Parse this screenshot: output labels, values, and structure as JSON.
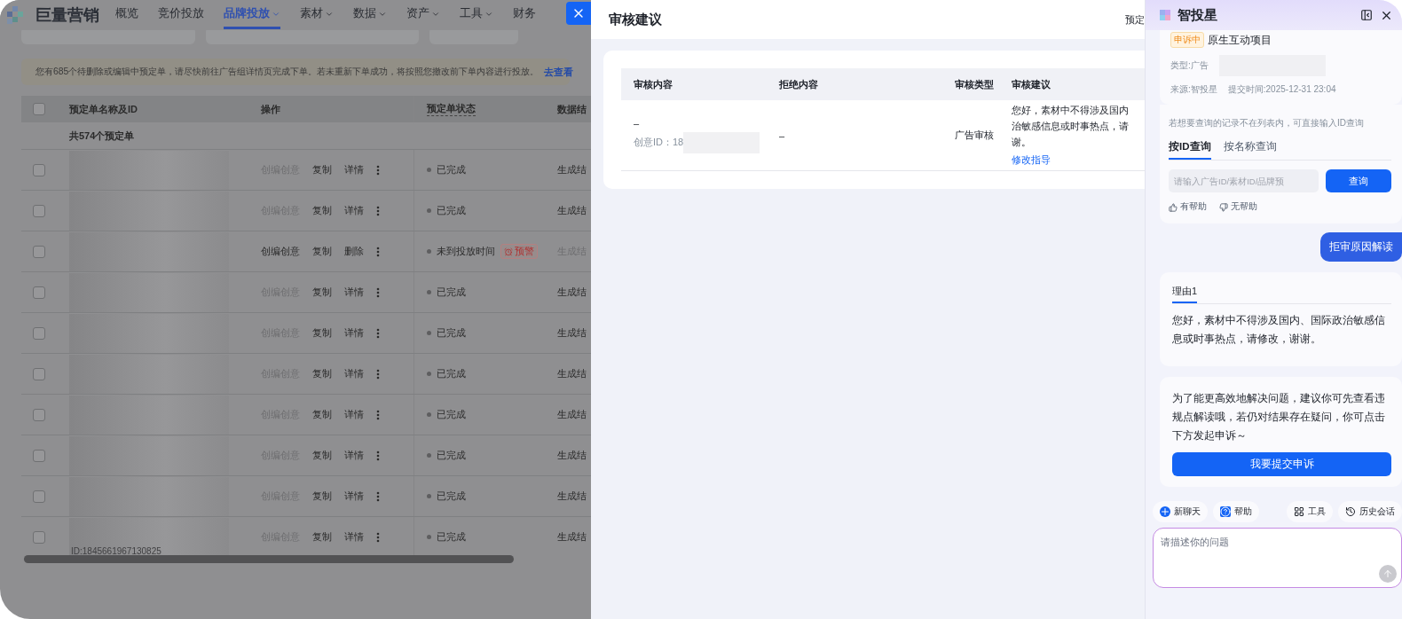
{
  "back_page": {
    "logo": "巨量营销",
    "nav": [
      {
        "label": "概览",
        "selected": false,
        "dropdown": false
      },
      {
        "label": "竞价投放",
        "selected": false,
        "dropdown": false
      },
      {
        "label": "品牌投放",
        "selected": true,
        "dropdown": true
      },
      {
        "label": "素材",
        "selected": false,
        "dropdown": true
      },
      {
        "label": "数据",
        "selected": false,
        "dropdown": true
      },
      {
        "label": "资产",
        "selected": false,
        "dropdown": true
      },
      {
        "label": "工具",
        "selected": false,
        "dropdown": true
      },
      {
        "label": "财务",
        "selected": false,
        "dropdown": false
      }
    ],
    "alert": {
      "text": "您有685个待删除或编辑中预定单，请尽快前往广告组详情页完成下单。若未重新下单成功，将按照您撤改前下单内容进行投放。",
      "link": "去查看"
    },
    "table": {
      "select_all_checked": false,
      "columns": [
        "预定单名称及ID",
        "操作",
        "预定单状态",
        "数据结"
      ],
      "summary": "共574个预定单",
      "rows": [
        {
          "checked": false,
          "actions": [
            {
              "label": "创编创意",
              "disabled": true
            },
            {
              "label": "复制",
              "disabled": false
            },
            {
              "label": "详情",
              "disabled": false
            }
          ],
          "status": "已完成",
          "col_5": "生成结",
          "col_5_disabled": false
        },
        {
          "checked": false,
          "actions": [
            {
              "label": "创编创意",
              "disabled": true
            },
            {
              "label": "复制",
              "disabled": false
            },
            {
              "label": "详情",
              "disabled": false
            }
          ],
          "status": "已完成",
          "col_5": "生成结",
          "col_5_disabled": false
        },
        {
          "checked": false,
          "actions": [
            {
              "label": "创编创意",
              "disabled": false
            },
            {
              "label": "复制",
              "disabled": false
            },
            {
              "label": "删除",
              "disabled": false
            }
          ],
          "status": "未到投放时间",
          "badge": "预警",
          "col_5": "生成结",
          "col_5_disabled": true
        },
        {
          "checked": false,
          "actions": [
            {
              "label": "创编创意",
              "disabled": true
            },
            {
              "label": "复制",
              "disabled": false
            },
            {
              "label": "详情",
              "disabled": false
            }
          ],
          "status": "已完成",
          "col_5": "生成结",
          "col_5_disabled": false
        },
        {
          "checked": false,
          "actions": [
            {
              "label": "创编创意",
              "disabled": true
            },
            {
              "label": "复制",
              "disabled": false
            },
            {
              "label": "详情",
              "disabled": false
            }
          ],
          "status": "已完成",
          "col_5": "生成结",
          "col_5_disabled": false
        },
        {
          "checked": false,
          "actions": [
            {
              "label": "创编创意",
              "disabled": true
            },
            {
              "label": "复制",
              "disabled": false
            },
            {
              "label": "详情",
              "disabled": false
            }
          ],
          "status": "已完成",
          "col_5": "生成结",
          "col_5_disabled": false
        },
        {
          "checked": false,
          "actions": [
            {
              "label": "创编创意",
              "disabled": true
            },
            {
              "label": "复制",
              "disabled": false
            },
            {
              "label": "详情",
              "disabled": false
            }
          ],
          "status": "已完成",
          "col_5": "生成结",
          "col_5_disabled": false
        },
        {
          "checked": false,
          "actions": [
            {
              "label": "创编创意",
              "disabled": true
            },
            {
              "label": "复制",
              "disabled": false
            },
            {
              "label": "详情",
              "disabled": false
            }
          ],
          "status": "已完成",
          "col_5": "生成结",
          "col_5_disabled": false
        },
        {
          "checked": false,
          "actions": [
            {
              "label": "创编创意",
              "disabled": true
            },
            {
              "label": "复制",
              "disabled": false
            },
            {
              "label": "详情",
              "disabled": false
            }
          ],
          "status": "已完成",
          "col_5": "生成结",
          "col_5_disabled": false
        },
        {
          "checked": false,
          "actions": [
            {
              "label": "创编创意",
              "disabled": true
            },
            {
              "label": "复制",
              "disabled": false
            },
            {
              "label": "详情",
              "disabled": false
            }
          ],
          "status": "已完成",
          "col_5": "生成结",
          "col_5_disabled": false,
          "id_text": "ID:1845661967130825"
        }
      ]
    }
  },
  "review_panel": {
    "title": "审核建议",
    "header_right": "预定",
    "table": {
      "columns": [
        "审核内容",
        "拒绝内容",
        "审核类型",
        "审核建议"
      ],
      "row": {
        "content": "–",
        "creative_id": "创意ID：18",
        "reject": "–",
        "type": "广告审核",
        "suggestion_lines": [
          "您好，素材中不得涉及国内",
          "治敏感信息或时事热点，请",
          "谢。"
        ],
        "link": "修改指导"
      }
    }
  },
  "assistant": {
    "title": "智投星",
    "record": {
      "tag": "申诉中",
      "name": "原生互动项目",
      "type": "类型:广告",
      "source": "来源:智投星",
      "time": "提交时间:2025-12-31 23:04"
    },
    "hint": "若想要查询的记录不在列表内，可直接输入ID查询",
    "tabs": [
      {
        "label": "按ID查询",
        "selected": true
      },
      {
        "label": "按名称查询",
        "selected": false
      }
    ],
    "search": {
      "placeholder": "请输入广告ID/素材ID/品牌预",
      "button": "查询"
    },
    "feedback": [
      "有帮助",
      "无帮助"
    ],
    "user_message": "拒审原因解读",
    "reason": {
      "tab": "理由1",
      "text": "您好，素材中不得涉及国内、国际政治敏感信息或时事热点，请修改，谢谢。"
    },
    "appeal": {
      "text": "为了能更高效地解决问题，建议你可先查看违规点解读哦，若仍对结果存在疑问，你可点击下方发起申诉～",
      "button": "我要提交申诉"
    },
    "toolbar": [
      {
        "kind": "new",
        "label": "新聊天"
      },
      {
        "kind": "help",
        "label": "帮助"
      },
      {
        "kind": "tools",
        "label": "工具"
      },
      {
        "kind": "history",
        "label": "历史会话"
      }
    ],
    "input": {
      "placeholder": "请描述你的问题"
    }
  }
}
